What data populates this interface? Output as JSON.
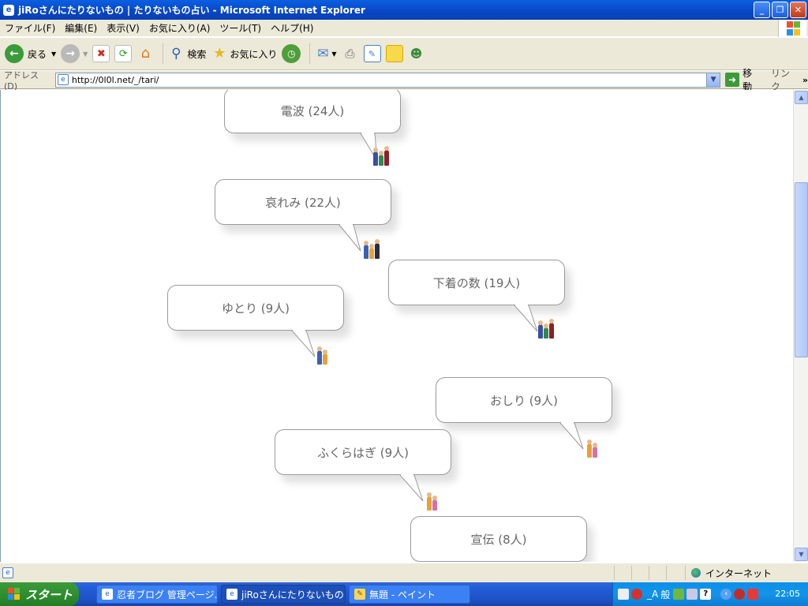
{
  "window": {
    "title": "jiRoさんにたりないもの | たりないもの占い - Microsoft Internet Explorer"
  },
  "menu": [
    "ファイル(F)",
    "編集(E)",
    "表示(V)",
    "お気に入り(A)",
    "ツール(T)",
    "ヘルプ(H)"
  ],
  "toolbar": {
    "back_label": "戻る",
    "search_label": "検索",
    "favorites_label": "お気に入り"
  },
  "address": {
    "label": "アドレス(D)",
    "url": "http://0l0l.net/_/tari/",
    "go_label": "移動",
    "links_label": "リンク"
  },
  "bubbles": [
    {
      "label": "電波 (24人)"
    },
    {
      "label": "哀れみ (22人)"
    },
    {
      "label": "下着の数 (19人)"
    },
    {
      "label": "ゆとり (9人)"
    },
    {
      "label": "おしり (9人)"
    },
    {
      "label": "ふくらはぎ (9人)"
    },
    {
      "label": "宣伝 (8人)"
    }
  ],
  "status": {
    "zone_label": "インターネット"
  },
  "taskbar": {
    "start_label": "スタート",
    "tasks": [
      {
        "label": "忍者ブログ 管理ページ..."
      },
      {
        "label": "jiRoさんにたりないもの |..."
      },
      {
        "label": "無題 - ペイント"
      }
    ],
    "ime_label": "般",
    "clock": "22:05"
  },
  "colors": {
    "title_blue": "#0846c4",
    "taskbar_blue": "#245edb",
    "start_green": "#2f8f2f",
    "chrome": "#ece9d8"
  }
}
